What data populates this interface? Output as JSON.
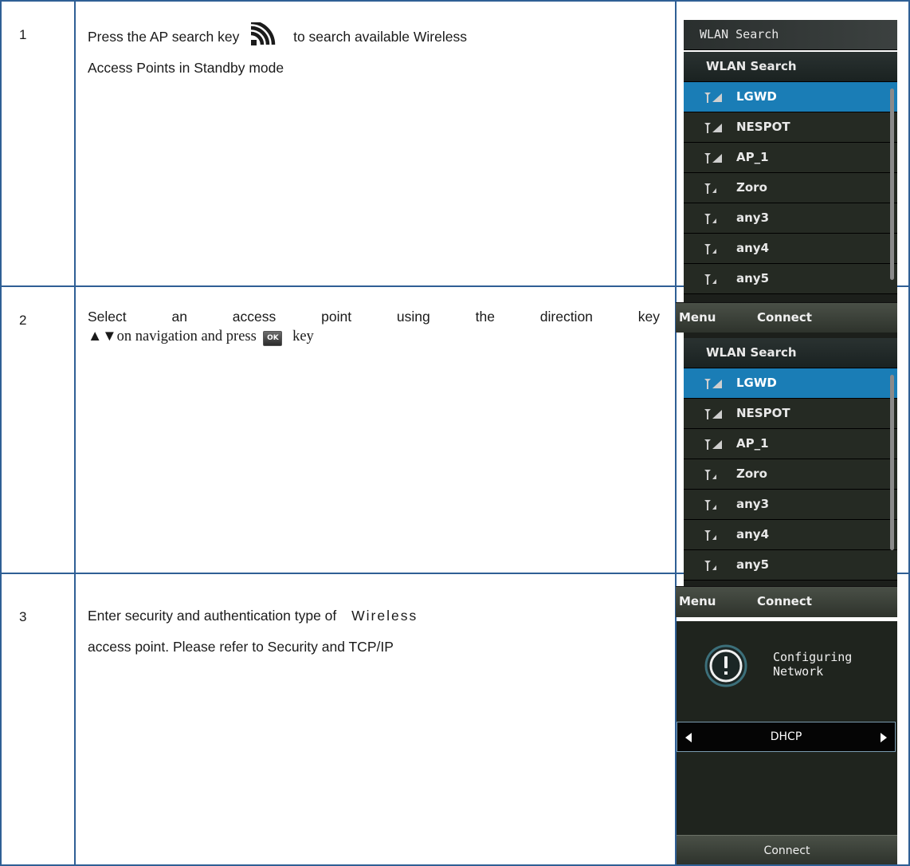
{
  "steps": [
    {
      "number": "1",
      "line1_before": "Press the AP search key",
      "line1_after": "to search available Wireless",
      "line2": "Access Points in Standby mode"
    },
    {
      "number": "2",
      "line1_words": [
        "Select",
        "an",
        "access",
        "point",
        "using",
        "the",
        "direction",
        "key"
      ],
      "line2_before": "▲▼on navigation and press",
      "ok_key_label": "OK",
      "line2_after": "key"
    },
    {
      "number": "3",
      "line1": "Enter security and authentication type of",
      "line1_spaced": "Wireless",
      "line2": "access point. Please refer to Security and TCP/IP"
    }
  ],
  "icons": {
    "ap_search_key": "wifi-signal-icon",
    "ok_key": "ok-key-icon",
    "signal": "signal-strength-icon",
    "alert": "exclamation-circle-icon",
    "arrow_left": "triangle-left-icon",
    "arrow_right": "triangle-right-icon"
  },
  "colors": {
    "grid": "#2f5f95",
    "selected_row": "#1a7db6",
    "phone_bg": "#1c1f1b"
  },
  "screen_top": {
    "title": "WLAN Search"
  },
  "screen_list_1": {
    "title": "WLAN Search",
    "items": [
      "LGWD",
      "NESPOT",
      "AP_1",
      "Zoro",
      "any3",
      "any4",
      "any5"
    ],
    "soft_left": "Menu",
    "soft_right": "Connect"
  },
  "screen_list_2": {
    "title": "WLAN Search",
    "items": [
      "LGWD",
      "NESPOT",
      "AP_1",
      "Zoro",
      "any3",
      "any4",
      "any5"
    ],
    "soft_left": "Menu",
    "soft_right": "Connect"
  },
  "screen_config": {
    "message_line1": "Configuring",
    "message_line2": "Network",
    "selector_value": "DHCP",
    "soft_center": "Connect"
  }
}
